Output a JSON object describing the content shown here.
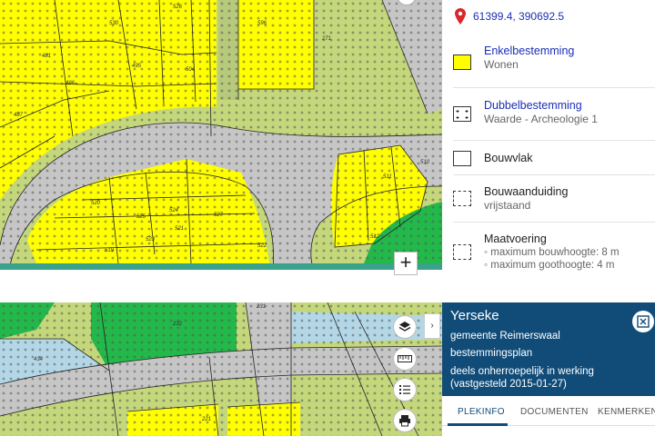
{
  "map_top": {
    "parcel_numbers": [
      "530",
      "526",
      "596",
      "271",
      "481",
      "495",
      "504",
      "496",
      "487",
      "520",
      "525",
      "524",
      "527",
      "521",
      "523",
      "519",
      "522",
      "511",
      "510",
      "512"
    ],
    "zoom_in_label": "+"
  },
  "map_bottom": {
    "parcel_numbers": [
      "232",
      "231",
      "434",
      "221"
    ],
    "tools": [
      {
        "name": "layers-icon"
      },
      {
        "name": "ruler-icon"
      },
      {
        "name": "legend-list-icon"
      },
      {
        "name": "print-icon"
      }
    ],
    "collapse_label": "›"
  },
  "legend": {
    "coordinates": "61399.4, 390692.5",
    "items": [
      {
        "title": "Enkelbestemming",
        "subtitle": "Wonen",
        "swatch": "yellow"
      },
      {
        "title": "Dubbelbestemming",
        "subtitle": "Waarde - Archeologie 1",
        "swatch": "dotted-cross"
      },
      {
        "title": "Bouwvlak",
        "swatch": "outline"
      },
      {
        "title": "Bouwaanduiding",
        "subtitle": "vrijstaand",
        "swatch": "dashed"
      },
      {
        "title": "Maatvoering",
        "bullets": [
          "maximum bouwhoogte: 8 m",
          "maximum goothoogte: 4 m"
        ],
        "swatch": "dashed"
      }
    ]
  },
  "info": {
    "title": "Yerseke",
    "municipality": "gemeente Reimerswaal",
    "plan_type": "bestemmingsplan",
    "status": "deels onherroepelijk in werking (vastgesteld 2015-01-27)",
    "tabs": [
      "PLEKINFO",
      "DOCUMENTEN",
      "KENMERKEN"
    ]
  },
  "colors": {
    "yellow_zone": "#ffff00",
    "green_zone": "#c4d77b",
    "bright_green": "#22b84a",
    "road_grey": "#c6c6c6",
    "water_blue": "#b4d7e8",
    "panel_blue": "#114c79",
    "link_blue": "#1c2fb5",
    "accent_teal": "#3aa18a"
  }
}
